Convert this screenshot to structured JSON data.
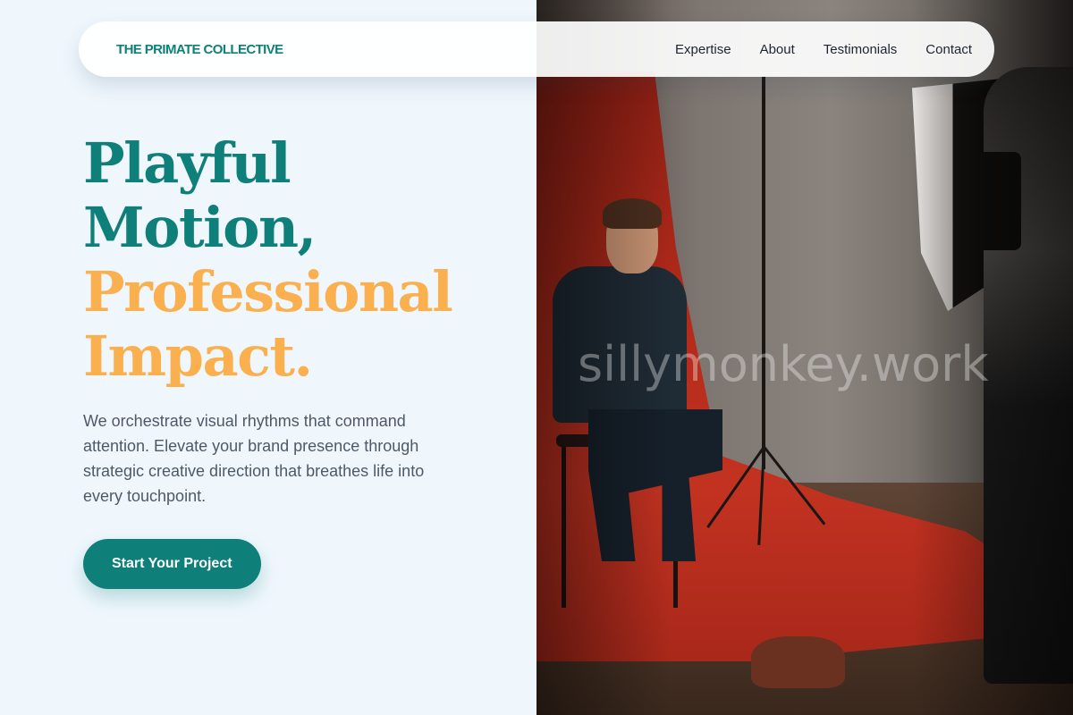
{
  "brand": {
    "name": "THE PRIMATE COLLECTIVE"
  },
  "nav": {
    "links": [
      {
        "label": "Expertise"
      },
      {
        "label": "About"
      },
      {
        "label": "Testimonials"
      },
      {
        "label": "Contact"
      }
    ]
  },
  "hero": {
    "headline_lines": [
      "Playful",
      "Motion,",
      "Professional",
      "Impact."
    ],
    "body": "We orchestrate visual rhythms that command attention. Elevate your brand presence through strategic creative direction that breathes life into every touchpoint.",
    "cta_label": "Start Your Project"
  },
  "photo": {
    "watermark": "sillymonkey.work"
  },
  "colors": {
    "teal": "#0e7f79",
    "gold": "#fbb04f",
    "background": "#eff7fd",
    "body_text": "#4e5966"
  }
}
